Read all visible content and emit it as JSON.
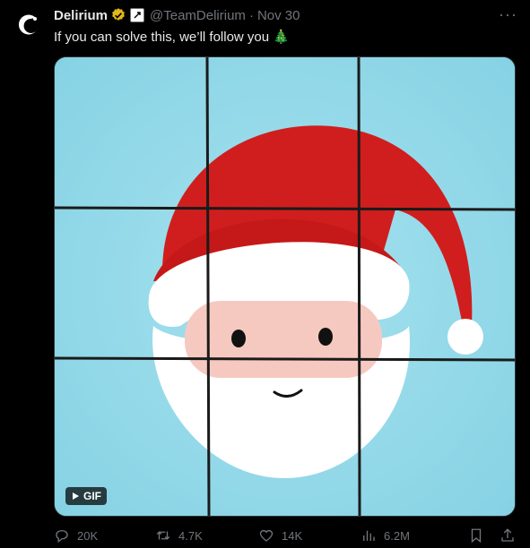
{
  "tweet": {
    "author_name": "Delirium",
    "handle": "@TeamDelirium",
    "separator": "·",
    "date": "Nov 30",
    "text": "If you can solve this, we’ll follow you 🎄",
    "more_label": "···"
  },
  "media": {
    "badge_label": "GIF",
    "background_color": "#8fd6e6",
    "grid": "3x3 puzzle tiles"
  },
  "actions": {
    "replies": "20K",
    "reposts": "4.7K",
    "likes": "14K",
    "views": "6.2M"
  },
  "colors": {
    "background": "#000000",
    "text": "#e7e9ea",
    "muted": "#71767b",
    "verified_gold": "#e2b719",
    "santa_red": "#d01e1e"
  },
  "icons": [
    "avatar-logo-icon",
    "verified-badge-icon",
    "affiliate-badge-icon",
    "more-icon",
    "play-icon",
    "reply-icon",
    "repost-icon",
    "like-icon",
    "views-icon",
    "bookmark-icon",
    "share-icon"
  ]
}
